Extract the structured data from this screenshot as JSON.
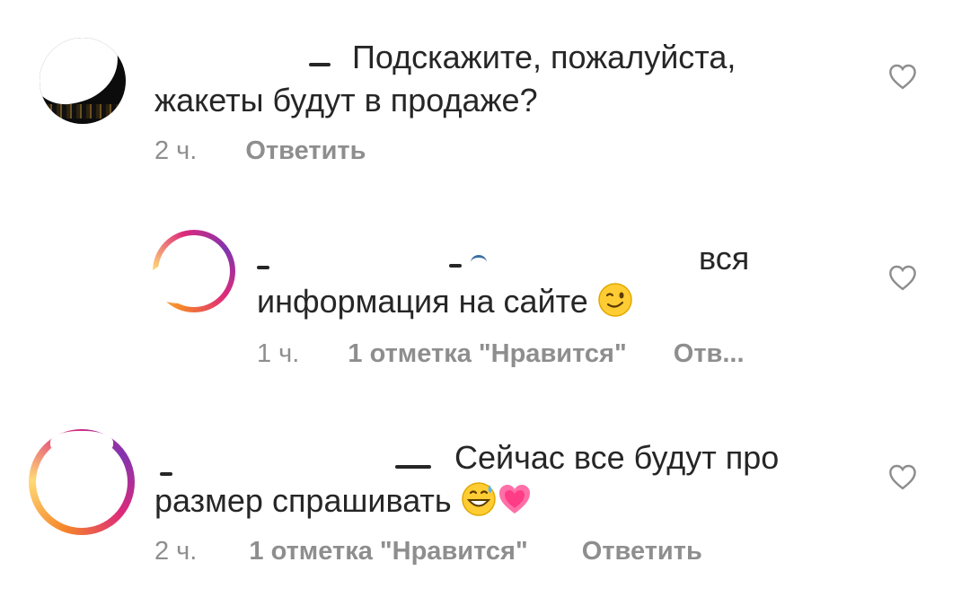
{
  "comments": [
    {
      "text_line1": "Подскажите, пожалуйста,",
      "text_line2": "жакеты будут в продаже?",
      "time": "2 ч.",
      "likes": "",
      "reply": "Ответить"
    },
    {
      "text_line1": "вся",
      "text_line2": "информация на сайте",
      "emoji": "winking-face",
      "time": "1 ч.",
      "likes": "1 отметка \"Нравится\"",
      "reply": "Отв..."
    },
    {
      "text_line1": "Сейчас все будут про",
      "text_line2": "размер  спрашивать",
      "emoji": "grinning-sweat-face, growing-heart",
      "time": "2 ч.",
      "likes": "1 отметка \"Нравится\"",
      "reply": "Ответить"
    }
  ],
  "icons": {
    "like": "heart-outline-icon"
  },
  "colors": {
    "text": "#262626",
    "meta": "#8e8e8e",
    "heart": "#8e8e8e",
    "story_ring_start": "#f58529",
    "story_ring_end": "#dd2a7b"
  }
}
